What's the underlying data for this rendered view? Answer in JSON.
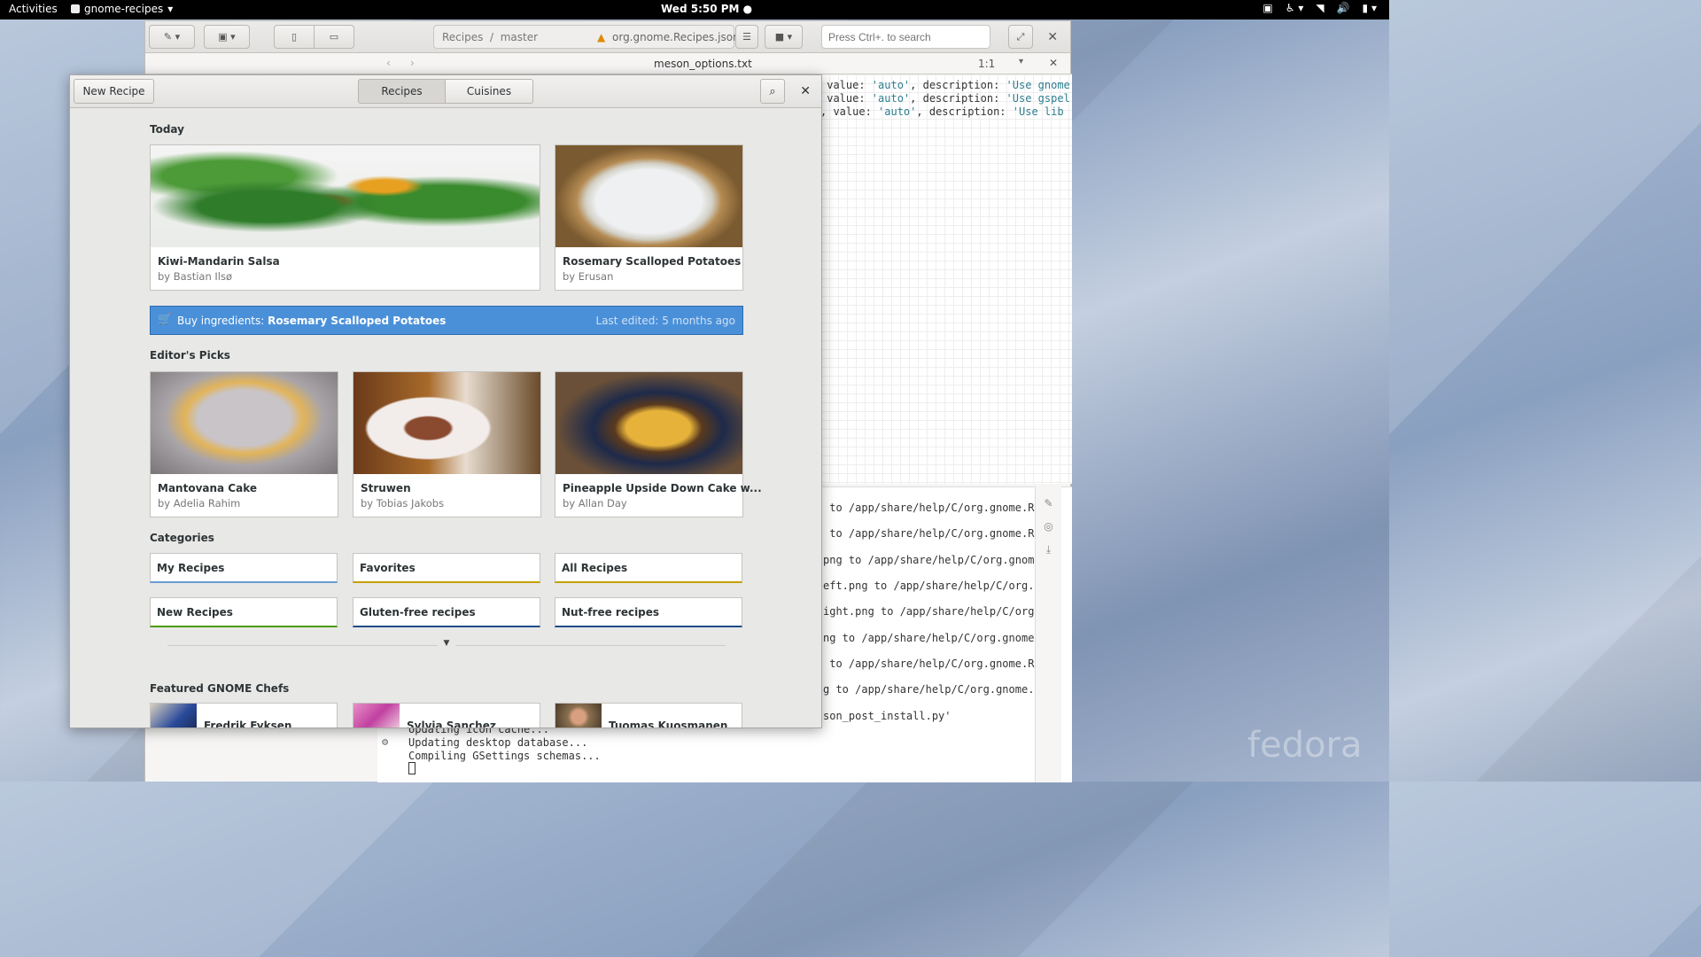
{
  "topbar": {
    "activities": "Activities",
    "app_name": "gnome-recipes",
    "clock": "Wed  5:50 PM ●",
    "tray": [
      "▣",
      "♿ ▾",
      "◥",
      "🔊",
      "▮ ▾"
    ]
  },
  "builder": {
    "path_project": "Recipes",
    "path_branch": "master",
    "path_file": "org.gnome.Recipes.json",
    "search_placeholder": "Press Ctrl+. to search",
    "tab_file": "meson_options.txt",
    "cursor_pos": "1:1",
    "editor_lines": [
      {
        "pre": " value: ",
        "str1": "'auto'",
        "mid": ", description: ",
        "str2": "'Use gnome"
      },
      {
        "pre": " value: ",
        "str1": "'auto'",
        "mid": ", description: ",
        "str2": "'Use gspel"
      },
      {
        "pre": ", value: ",
        "str1": "'auto'",
        "mid": ", description: ",
        "str2": "'Use lib"
      }
    ],
    "terminal_lines": [
      " to /app/share/help/C/org.gnome.R",
      " to /app/share/help/C/org.gnome.R",
      "png to /app/share/help/C/org.gnom",
      "eft.png to /app/share/help/C/org.",
      "ight.png to /app/share/help/C/org",
      "ng to /app/share/help/C/org.gnome",
      " to /app/share/help/C/org.gnome.R",
      "g to /app/share/help/C/org.gnome.",
      "son_post_install.py'"
    ],
    "terminal_bottom": [
      "Updating icon cache...",
      "Updating desktop database...",
      "Compiling GSettings schemas..."
    ]
  },
  "recipes": {
    "new_recipe": "New Recipe",
    "tab_recipes": "Recipes",
    "tab_cuisines": "Cuisines",
    "today_title": "Today",
    "today": [
      {
        "title": "Kiwi-Mandarin Salsa",
        "author": "by Bastian Ilsø"
      },
      {
        "title": "Rosemary Scalloped Potatoes",
        "author": "by Erusan"
      }
    ],
    "shopping": {
      "label": "Buy ingredients:",
      "recipe": "Rosemary Scalloped Potatoes",
      "edited": "Last edited: 5 months ago"
    },
    "picks_title": "Editor's Picks",
    "picks": [
      {
        "title": "Mantovana Cake",
        "author": "by Adelia Rahim"
      },
      {
        "title": "Struwen",
        "author": "by Tobias Jakobs"
      },
      {
        "title": "Pineapple Upside Down Cake w...",
        "author": "by Allan Day"
      }
    ],
    "categories_title": "Categories",
    "categories": [
      {
        "label": "My Recipes",
        "color": "#6a9bd1"
      },
      {
        "label": "Favorites",
        "color": "#c4a000"
      },
      {
        "label": "All Recipes",
        "color": "#c4a000"
      },
      {
        "label": "New Recipes",
        "color": "#4e9a06"
      },
      {
        "label": "Gluten-free recipes",
        "color": "#204a87"
      },
      {
        "label": "Nut-free recipes",
        "color": "#204a87"
      }
    ],
    "chefs_title": "Featured GNOME Chefs",
    "chefs": [
      "Fredrik Fyksen",
      "Sylvia Sanchez",
      "Tuomas Kuosmanen"
    ]
  },
  "wallpaper_brand": "fedora"
}
